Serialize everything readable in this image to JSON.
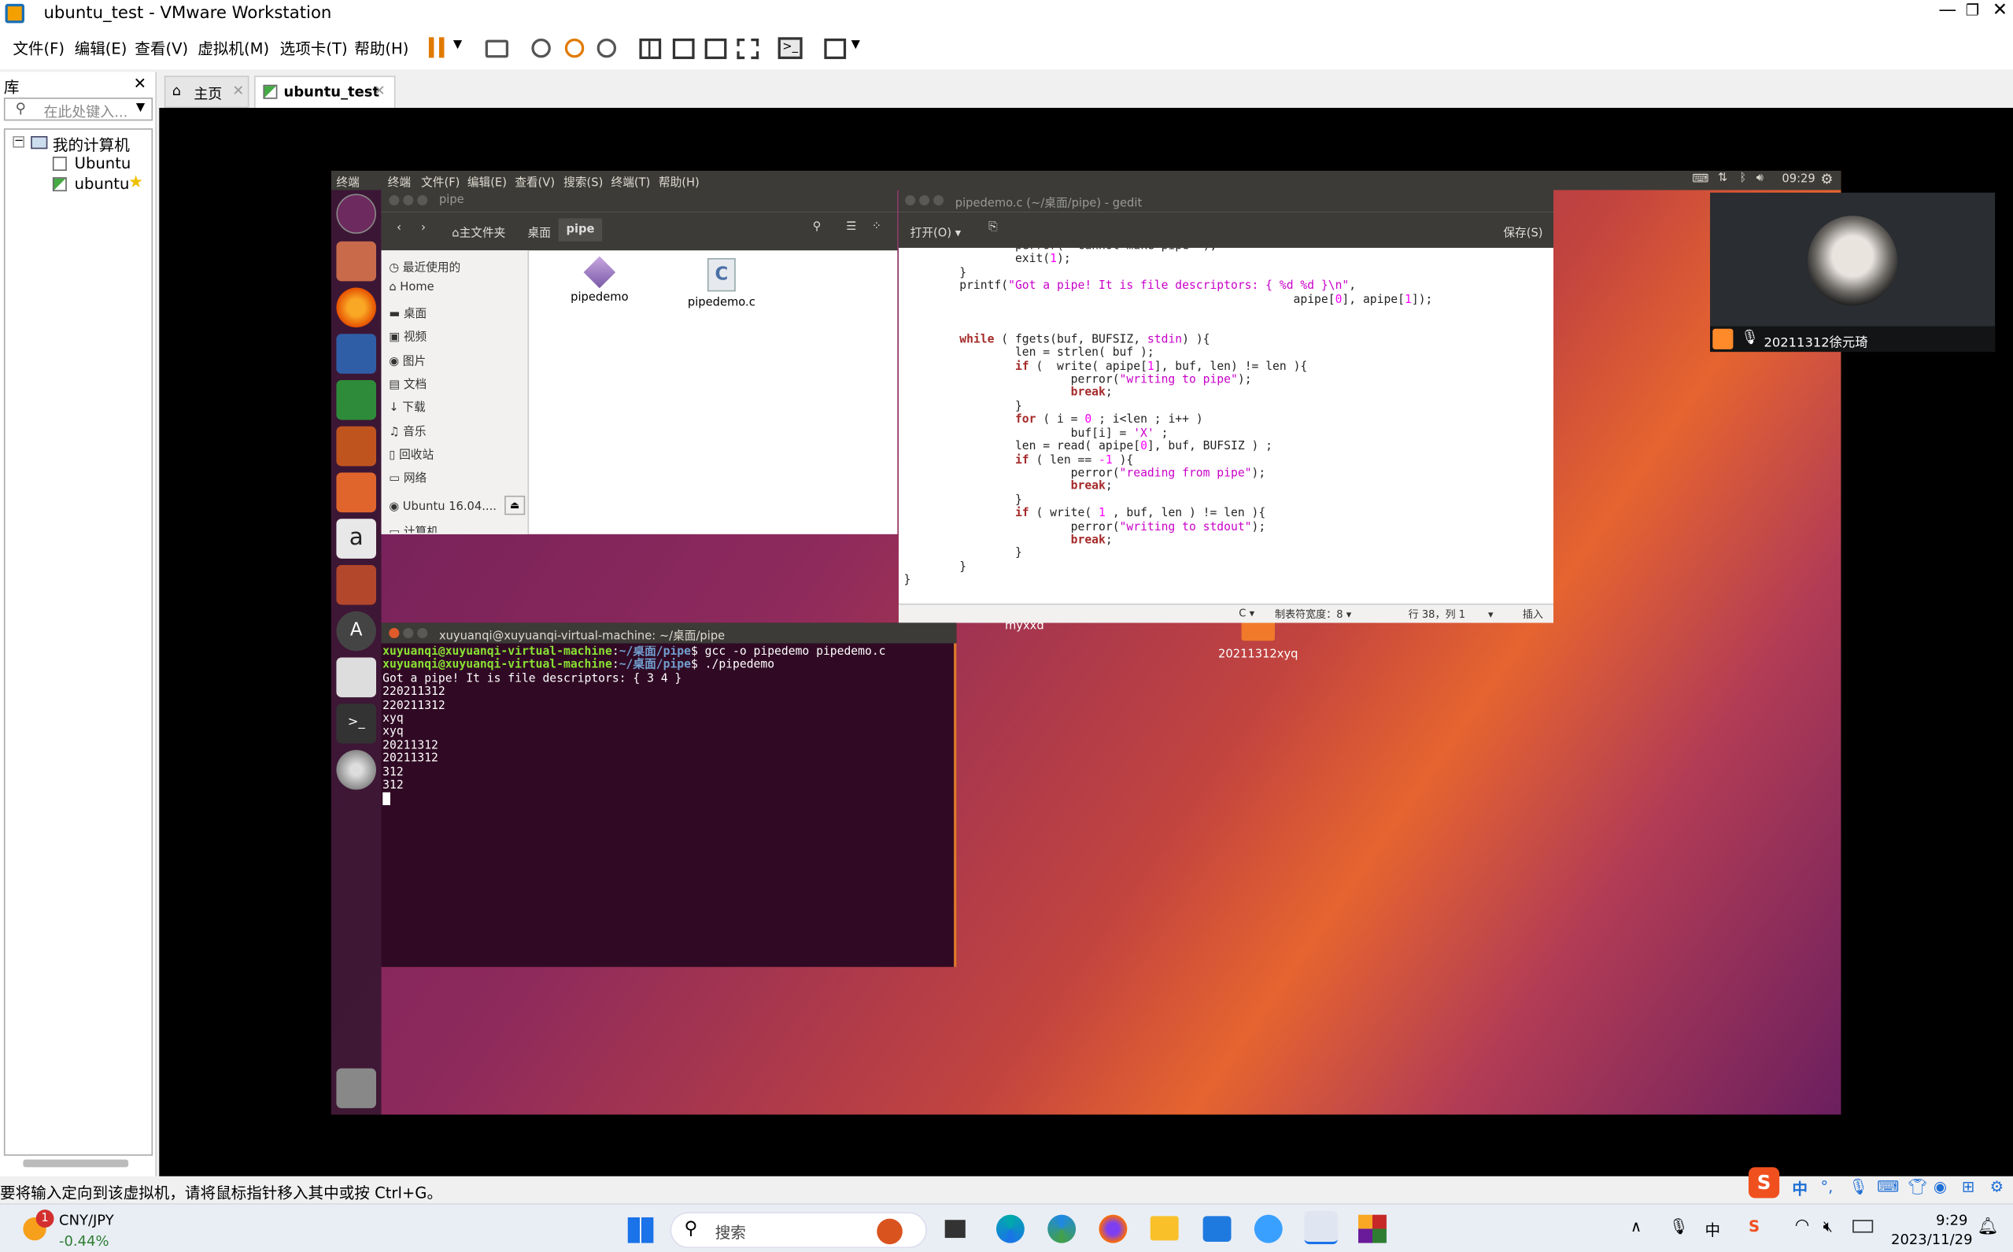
{
  "window": {
    "title": "ubuntu_test - VMware Workstation"
  },
  "menu": [
    "文件(F)",
    "编辑(E)",
    "查看(V)",
    "虚拟机(M)",
    "选项卡(T)",
    "帮助(H)"
  ],
  "library": {
    "title": "库",
    "search_placeholder": "在此处键入...",
    "tree": {
      "root": "我的计算机",
      "items": [
        "Ubuntu",
        "ubuntu"
      ]
    }
  },
  "tabs": [
    {
      "label": "主页"
    },
    {
      "label": "ubuntu_test"
    }
  ],
  "statusbar": {
    "hint": "要将输入定向到该虚拟机，请将鼠标指针移入其中或按 Ctrl+G。"
  },
  "ubuntu": {
    "topbar": {
      "app": "终端",
      "menus": [
        "终端",
        "文件(F)",
        "编辑(E)",
        "查看(V)",
        "搜索(S)",
        "终端(T)",
        "帮助(H)"
      ],
      "time": "09:29"
    },
    "files": {
      "title": "pipe",
      "path": [
        "主文件夹",
        "桌面",
        "pipe"
      ],
      "sidebar": [
        "最近使用的",
        "Home",
        "桌面",
        "视频",
        "图片",
        "文档",
        "下载",
        "音乐",
        "回收站",
        "网络",
        "Ubuntu 16.04....",
        "计算机"
      ],
      "items": [
        "pipedemo",
        "pipedemo.c"
      ]
    },
    "gedit": {
      "title": "pipedemo.c (~/桌面/pipe) - gedit",
      "open": "打开(O)",
      "save": "保存(S)",
      "status": {
        "lang": "C",
        "tab": "制表符宽度：8",
        "pos": "行 38，列 1",
        "mode": "插入"
      }
    },
    "terminal": {
      "title": "xuyuanqi@xuyuanqi-virtual-machine: ~/桌面/pipe",
      "prompt_user": "xuyuanqi@xuyuanqi-virtual-machine",
      "prompt_path": "~/桌面/pipe",
      "cmd1": "gcc -o pipedemo pipedemo.c",
      "cmd2": "./pipedemo",
      "output": [
        "Got a pipe! It is file descriptors: { 3 4 }",
        "220211312",
        "220211312",
        "xyq",
        "xyq",
        "20211312",
        "20211312",
        "312",
        "312"
      ]
    },
    "desktop_icons": [
      "myxxd",
      "20211312xyq"
    ]
  },
  "webcam": {
    "name": "20211312徐元琦"
  },
  "taskbar": {
    "stock": "CNY/JPY",
    "change": "-0.44%",
    "badge": "1",
    "search": "搜索",
    "time": "9:29",
    "date": "2023/11/29",
    "ime": "中"
  }
}
